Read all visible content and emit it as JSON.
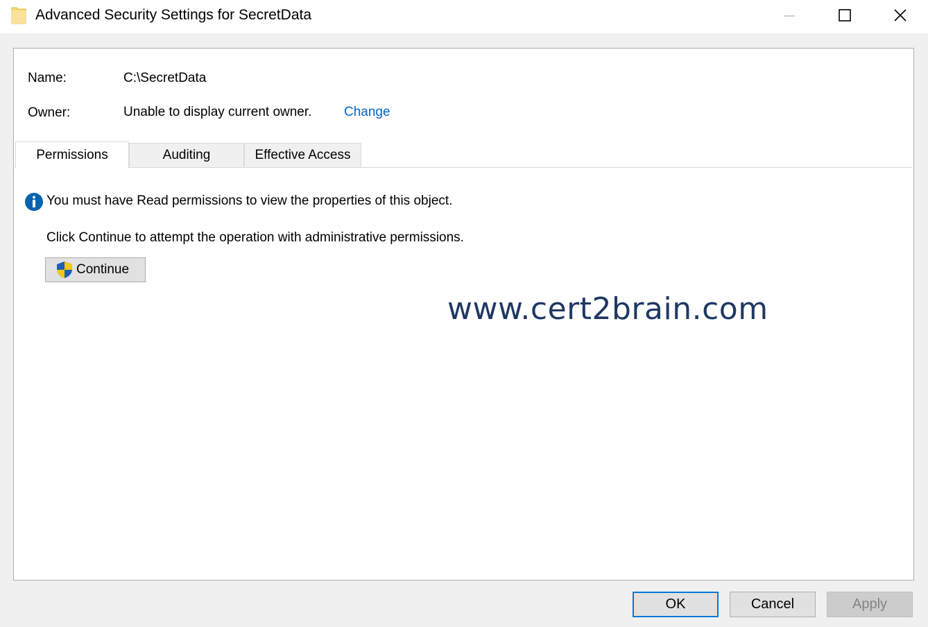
{
  "window": {
    "title": "Advanced Security Settings for SecretData",
    "icon": "folder-icon",
    "controls": {
      "minimize": "minimize-icon",
      "maximize": "maximize-icon",
      "close": "close-icon"
    }
  },
  "header": {
    "name_label": "Name:",
    "name_value": "C:\\SecretData",
    "owner_label": "Owner:",
    "owner_value": "Unable to display current owner.",
    "owner_change_link": "Change"
  },
  "tabs": [
    {
      "label": "Permissions",
      "active": true
    },
    {
      "label": "Auditing",
      "active": false
    },
    {
      "label": "Effective Access",
      "active": false
    }
  ],
  "content": {
    "info_icon": "info-icon",
    "info_message": "You must have Read permissions to view the properties of this object.",
    "instruction": "Click Continue to attempt the operation with administrative permissions.",
    "continue_button": {
      "label": "Continue",
      "icon": "uac-shield-icon"
    }
  },
  "watermark": "www.cert2brain.com",
  "footer": {
    "ok_label": "OK",
    "cancel_label": "Cancel",
    "apply_label": "Apply",
    "apply_enabled": false
  },
  "colors": {
    "link": "#0066cc",
    "accent_focus": "#0078d7",
    "watermark": "#1f3864",
    "info_icon": "#0063b1"
  }
}
